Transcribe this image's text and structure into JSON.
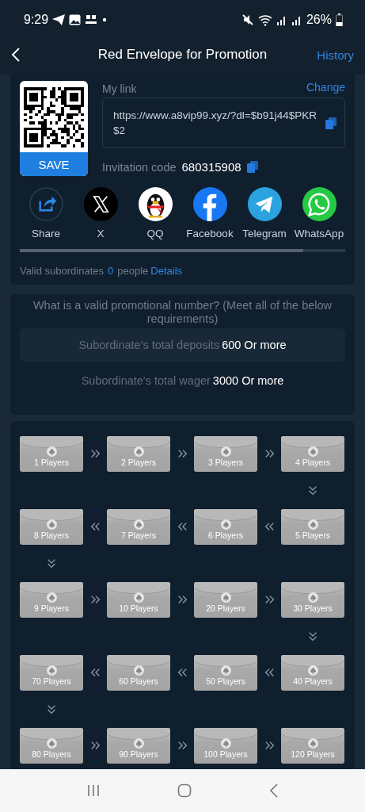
{
  "status_bar": {
    "time": "9:29",
    "battery": "26%"
  },
  "header": {
    "title": "Red Envelope for Promotion",
    "action": "History"
  },
  "invite": {
    "save_button": "SAVE",
    "link_label": "My link",
    "change": "Change",
    "link": "https://www.a8vip99.xyz/?dl=$b91j44$PKR$2",
    "code_label": "Invitation code",
    "code": "680315908"
  },
  "share_targets": [
    {
      "kind": "share",
      "label": "Share"
    },
    {
      "kind": "x",
      "label": "X"
    },
    {
      "kind": "qq",
      "label": "QQ"
    },
    {
      "kind": "facebook",
      "label": "Facebook"
    },
    {
      "kind": "telegram",
      "label": "Telegram"
    },
    {
      "kind": "whatsapp",
      "label": "WhatsApp"
    }
  ],
  "subordinates": {
    "label": "Valid subordinates",
    "count": "0",
    "unit": "people",
    "link": "Details"
  },
  "requirements": {
    "title": "What is a valid promotional number? (Meet all of the below requirements)",
    "rows": [
      {
        "label": "Subordinate's total deposits",
        "value": "600 Or more"
      },
      {
        "label": "Subordinate's total wager",
        "value": "3000 Or more"
      }
    ]
  },
  "envelope_rows": [
    {
      "kind": "right",
      "labels": [
        "1 Players",
        "2 Players",
        "3 Players",
        "4 Players"
      ]
    },
    {
      "kind": "left",
      "labels": [
        "8 Players",
        "7 Players",
        "6 Players",
        "5 Players"
      ]
    },
    {
      "kind": "right",
      "labels": [
        "9 Players",
        "10 Players",
        "20 Players",
        "30 Players"
      ]
    },
    {
      "kind": "left",
      "labels": [
        "70 Players",
        "60 Players",
        "50 Players",
        "40 Players"
      ]
    },
    {
      "kind": "right",
      "labels": [
        "80 Players",
        "90 Players",
        "100 Players",
        "120 Players"
      ]
    }
  ]
}
